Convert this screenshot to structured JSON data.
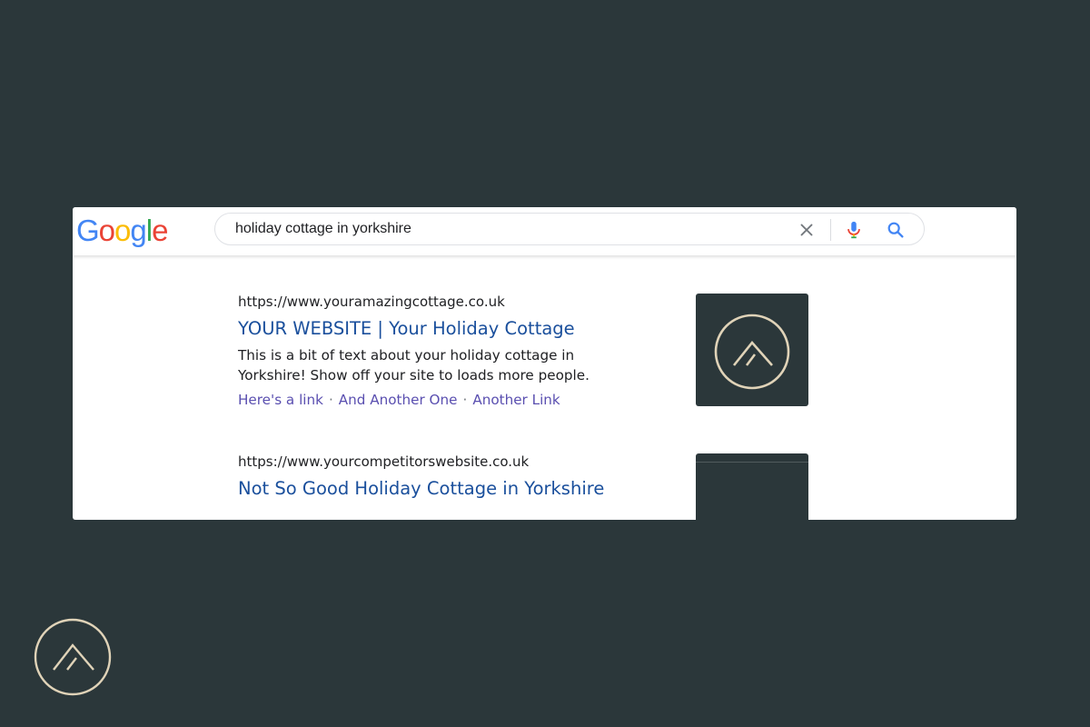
{
  "search": {
    "query": "holiday cottage in yorkshire"
  },
  "logo": {
    "letters": [
      "G",
      "o",
      "o",
      "g",
      "l",
      "e"
    ],
    "colors": [
      "#4285F4",
      "#EA4335",
      "#FBBC05",
      "#4285F4",
      "#34A853",
      "#EA4335"
    ]
  },
  "icons": {
    "clear": "close-icon",
    "mic": "microphone-icon",
    "search": "search-icon",
    "brand": "mountain-logo"
  },
  "results": [
    {
      "url": "https://www.youramazingcottage.co.uk",
      "title": "YOUR WEBSITE | Your Holiday Cottage",
      "snippet": "This is a bit of text about your holiday cottage in Yorkshire! Show off your site to loads more people.",
      "sitelinks": [
        "Here's a link",
        "And Another One",
        "Another Link"
      ]
    },
    {
      "url": "https://www.yourcompetitorswebsite.co.uk",
      "title": "Not So Good Holiday Cottage in Yorkshire"
    }
  ],
  "colors": {
    "background": "#2b373a",
    "title_link": "#1a4f9c",
    "sitelink": "#5a4fb0",
    "brand_line": "#e0d3b8"
  }
}
